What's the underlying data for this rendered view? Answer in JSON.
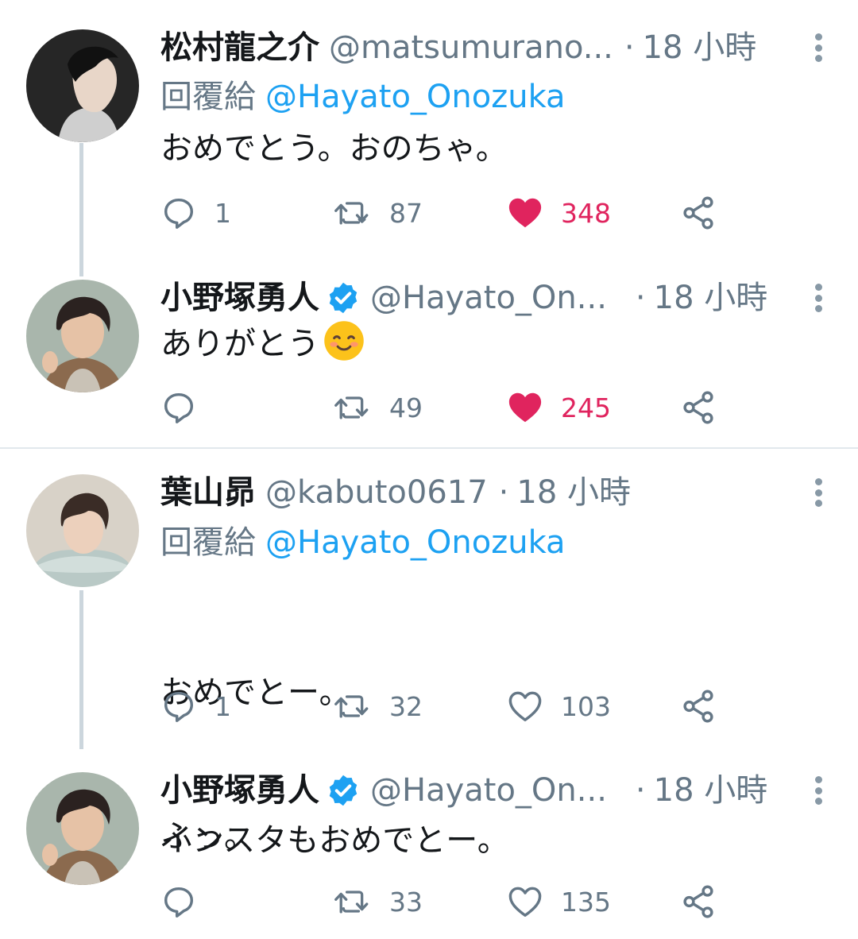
{
  "tweets": [
    {
      "display_name": "松村龍之介",
      "handle": "@matsumurano...",
      "dot": "·",
      "time": "18 小時",
      "reply_prefix": "回覆給",
      "reply_mention": "@Hayato_Onozuka",
      "text": "おめでとう。おのちゃ。",
      "replies": "1",
      "retweets": "87",
      "likes": "348",
      "liked": true
    },
    {
      "display_name": "小野塚勇人",
      "handle": "@Hayato_On...",
      "dot": "·",
      "time": "18 小時",
      "verified": true,
      "text": "ありがとう",
      "emoji": "smiling-face-emoji",
      "replies": "",
      "retweets": "49",
      "likes": "245",
      "liked": true
    },
    {
      "display_name": "葉山昴",
      "handle": "@kabuto0617",
      "dot": "·",
      "time": "18 小時",
      "reply_prefix": "回覆給",
      "reply_mention": "@Hayato_Onozuka",
      "text_line1": "おめでとー。",
      "text_line2": "インスタもおめでとー。",
      "replies": "1",
      "retweets": "32",
      "likes": "103",
      "liked": false
    },
    {
      "display_name": "小野塚勇人",
      "handle": "@Hayato_On...",
      "dot": "·",
      "time": "18 小時",
      "verified": true,
      "text": "ふっ。",
      "replies": "",
      "retweets": "33",
      "likes": "135",
      "liked": false
    }
  ],
  "icons": {
    "reply": "reply-icon",
    "retweet": "retweet-icon",
    "like": "heart-icon",
    "share": "share-icon",
    "more": "more-vertical-icon",
    "verified": "verified-badge-icon"
  },
  "colors": {
    "link": "#1da1f2",
    "secondary_text": "#657786",
    "like_active": "#e0245e",
    "divider": "#e1e8ed",
    "thread_line": "#ccd6dd"
  }
}
